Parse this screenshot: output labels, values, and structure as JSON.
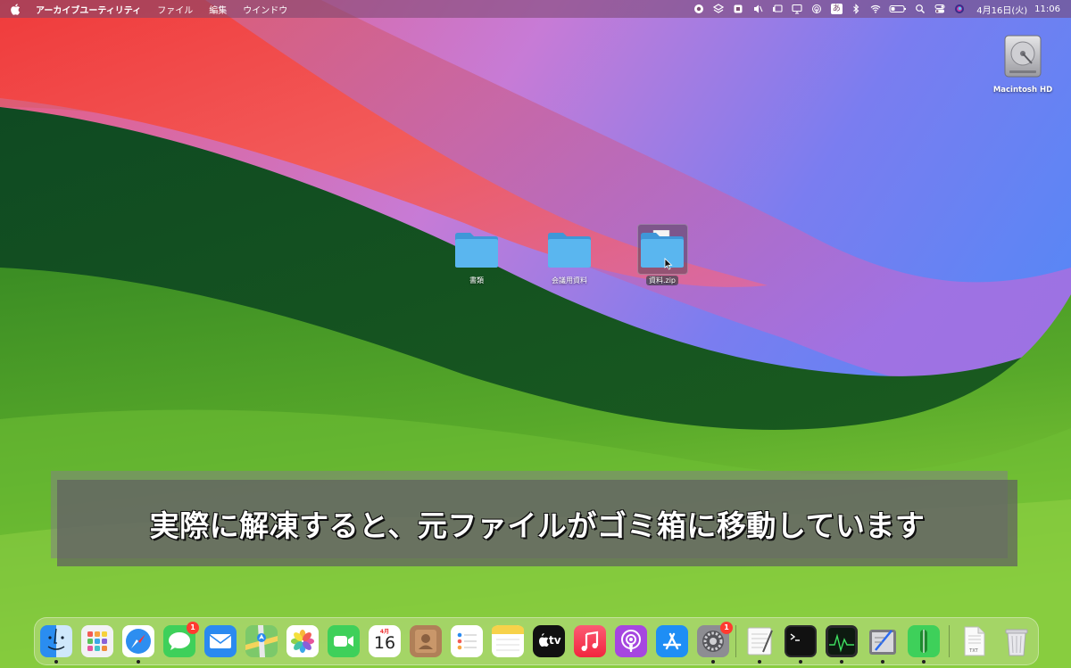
{
  "menubar": {
    "app_name": "アーカイブユーティリティ",
    "menus": [
      "ファイル",
      "編集",
      "ウインドウ"
    ],
    "input_mode": "あ",
    "date": "4月16日(火)",
    "time": "11:06"
  },
  "desktop": {
    "drive": {
      "label": "Macintosh HD",
      "icon": "hard-drive-icon"
    },
    "folders": [
      {
        "label": "書類",
        "icon": "folder-icon"
      },
      {
        "label": "会議用資料",
        "icon": "folder-icon"
      },
      {
        "label": "資料.zip",
        "icon": "folder-icon",
        "selected": true
      }
    ]
  },
  "caption": {
    "text": "実際に解凍すると、元ファイルがゴミ箱に移動しています"
  },
  "dock": {
    "apps": [
      {
        "name": "Finder",
        "icon": "finder-icon",
        "running": true
      },
      {
        "name": "Launchpad",
        "icon": "launchpad-icon",
        "running": false
      },
      {
        "name": "Safari",
        "icon": "safari-icon",
        "running": true
      },
      {
        "name": "メッセージ",
        "icon": "messages-icon",
        "running": false,
        "badge": "1"
      },
      {
        "name": "メール",
        "icon": "mail-icon",
        "running": false
      },
      {
        "name": "マップ",
        "icon": "maps-icon",
        "running": false
      },
      {
        "name": "写真",
        "icon": "photos-icon",
        "running": false
      },
      {
        "name": "FaceTime",
        "icon": "facetime-icon",
        "running": false
      },
      {
        "name": "カレンダー",
        "icon": "calendar-icon",
        "running": false,
        "month": "4月",
        "day": "16"
      },
      {
        "name": "連絡先",
        "icon": "contacts-icon",
        "running": false
      },
      {
        "name": "リマインダー",
        "icon": "reminders-icon",
        "running": false
      },
      {
        "name": "メモ",
        "icon": "notes-icon",
        "running": false
      },
      {
        "name": "TV",
        "icon": "tv-icon",
        "running": false,
        "text": "tv"
      },
      {
        "name": "ミュージック",
        "icon": "music-icon",
        "running": false
      },
      {
        "name": "Podcast",
        "icon": "podcasts-icon",
        "running": false
      },
      {
        "name": "App Store",
        "icon": "app-store-icon",
        "running": false
      },
      {
        "name": "システム設定",
        "icon": "system-settings-icon",
        "running": true,
        "badge": "1"
      },
      {
        "name": "テキストエディット",
        "icon": "textedit-icon",
        "running": true
      },
      {
        "name": "ターミナル",
        "icon": "terminal-icon",
        "running": true
      },
      {
        "name": "アクティビティモニタ",
        "icon": "activity-monitor-icon",
        "running": true
      },
      {
        "name": "スクリプトエディタ",
        "icon": "script-editor-icon",
        "running": true
      },
      {
        "name": "ボイスメモ",
        "icon": "voice-memo-icon",
        "running": true
      },
      {
        "name": "書類",
        "icon": "document-icon",
        "running": false,
        "text": "TXT"
      },
      {
        "name": "ゴミ箱",
        "icon": "trash-icon",
        "running": false
      }
    ]
  },
  "colors": {
    "accent_folder": "#5ab6ef",
    "badge": "#ff3b30"
  }
}
